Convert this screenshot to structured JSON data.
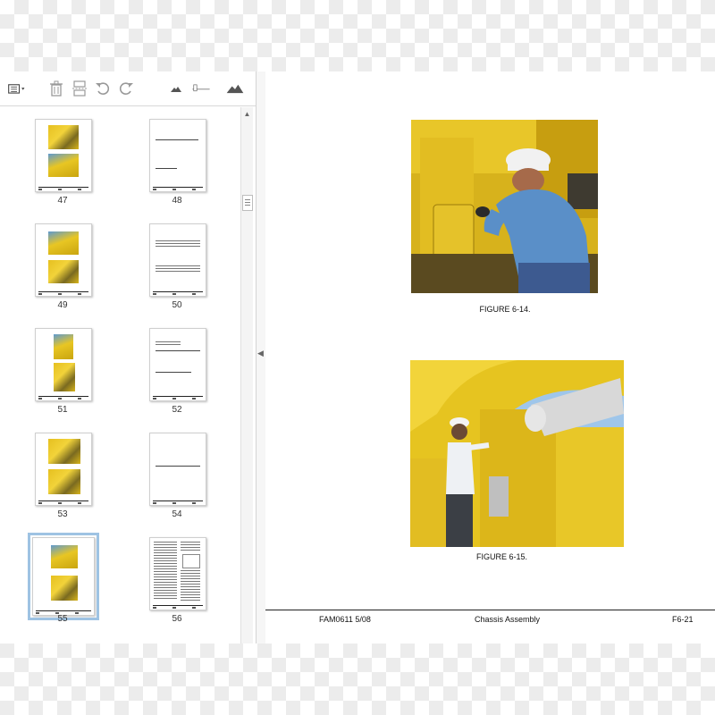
{
  "toolbar": {
    "icons": [
      "thumbnail-options-icon",
      "delete-icon",
      "extract-pages-icon",
      "rotate-left-icon",
      "rotate-right-icon",
      "zoom-out-icon",
      "zoom-slider",
      "zoom-in-icon"
    ]
  },
  "thumbnails": {
    "pages": [
      {
        "number": "47",
        "kind": "photos"
      },
      {
        "number": "48",
        "kind": "text-sparse"
      },
      {
        "number": "49",
        "kind": "photos"
      },
      {
        "number": "50",
        "kind": "text-sparse"
      },
      {
        "number": "51",
        "kind": "photos"
      },
      {
        "number": "52",
        "kind": "text-sparse"
      },
      {
        "number": "53",
        "kind": "photos"
      },
      {
        "number": "54",
        "kind": "text-sparse"
      },
      {
        "number": "55",
        "kind": "photos",
        "selected": true
      },
      {
        "number": "56",
        "kind": "text-dense"
      }
    ]
  },
  "document": {
    "figure1_caption": "FIGURE 6-14.",
    "figure2_caption": "FIGURE 6-15.",
    "footer": {
      "left": "FAM0611  5/08",
      "center": "Chassis Assembly",
      "right": "F6-21"
    }
  },
  "colors": {
    "machine_yellow": "#e6c21e",
    "shirt_blue": "#5a8fc8",
    "selection_outline": "#9ec3e3"
  }
}
